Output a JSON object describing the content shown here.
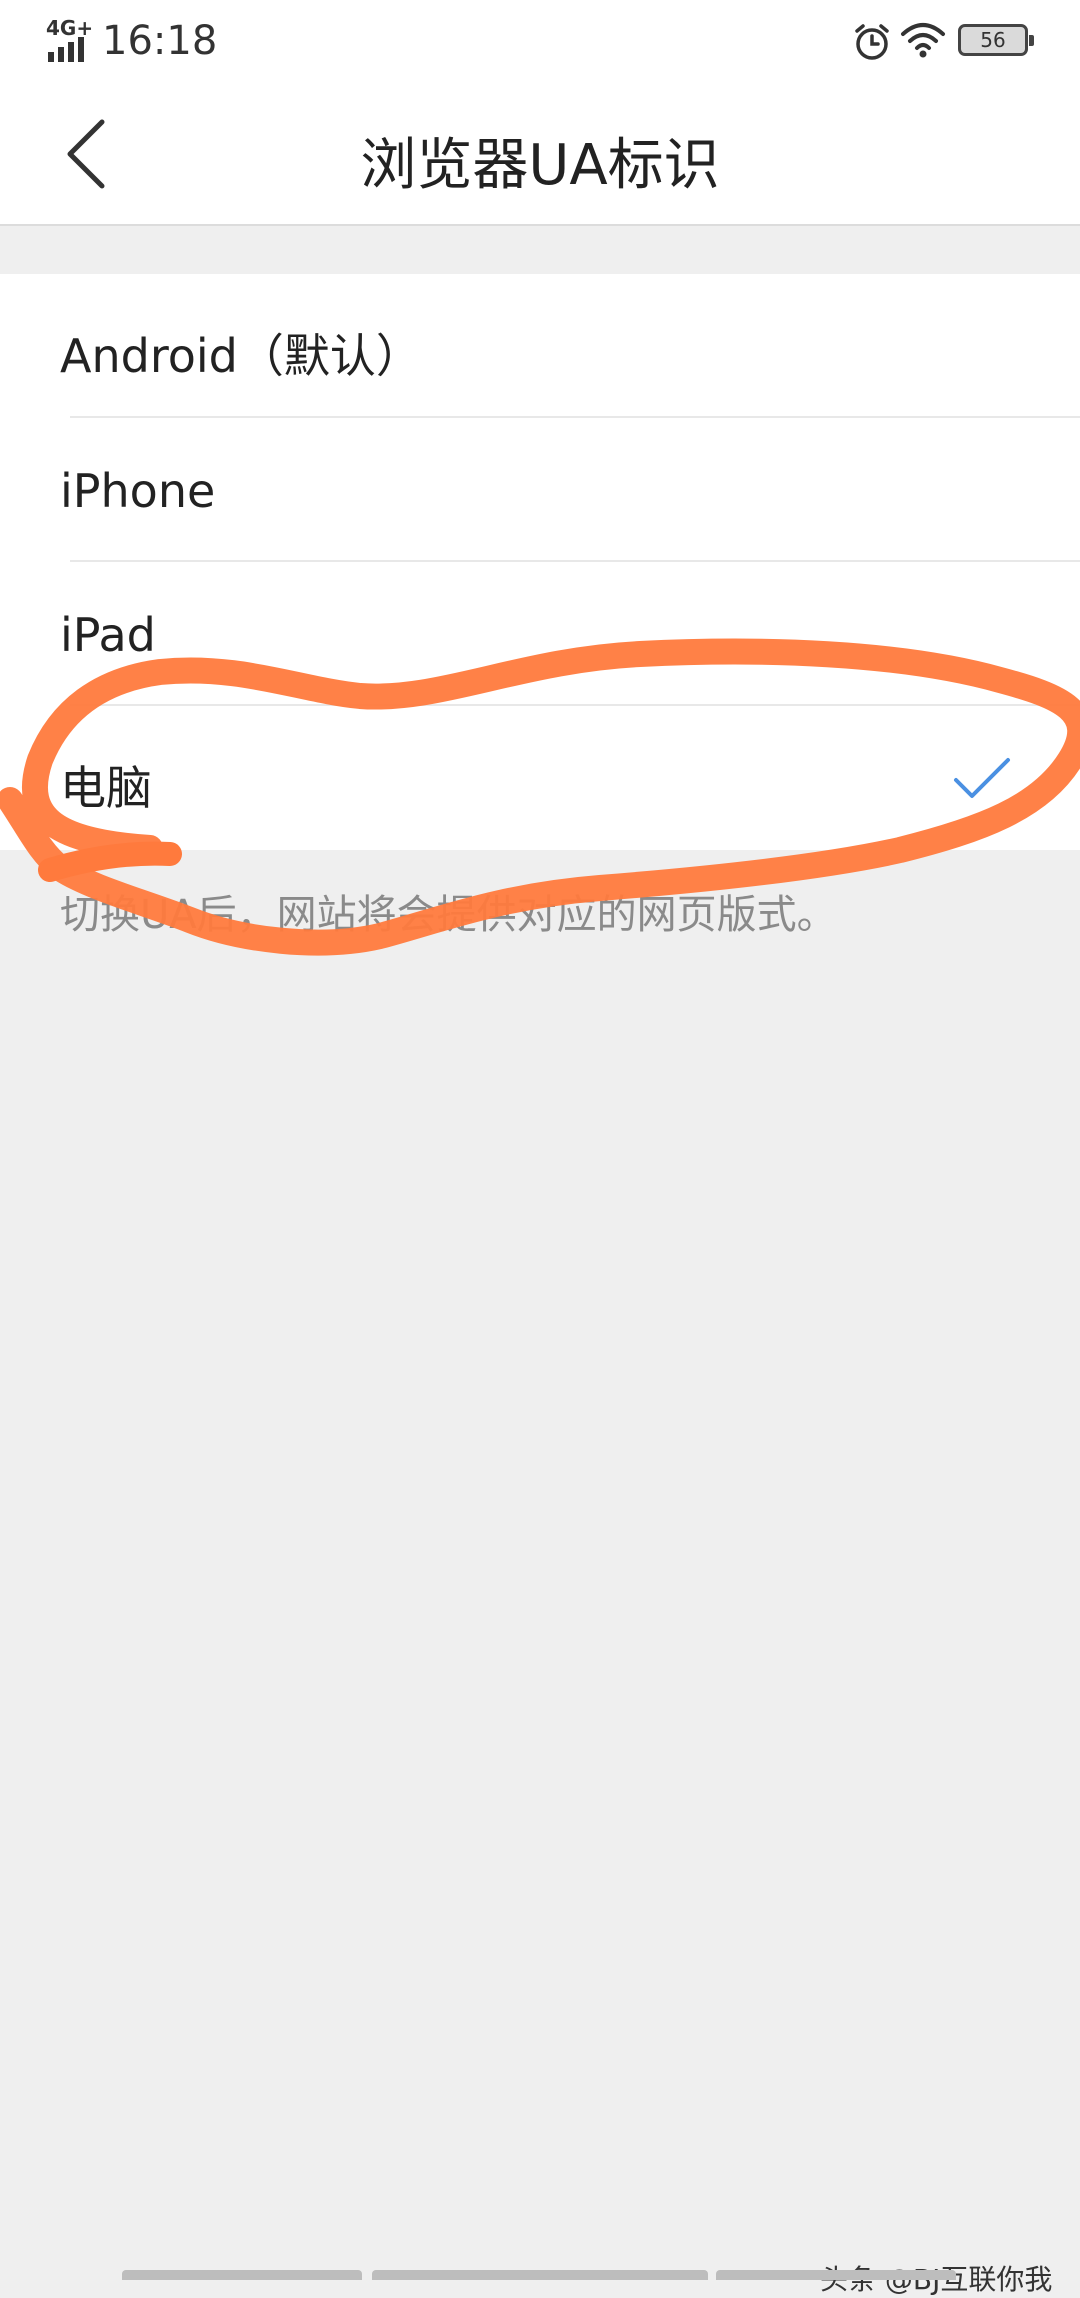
{
  "status_bar": {
    "network": "4G+",
    "time": "16:18",
    "battery": "56",
    "icons": [
      "signal-icon",
      "alarm-icon",
      "wifi-icon",
      "battery-icon"
    ]
  },
  "header": {
    "title": "浏览器UA标识",
    "back_icon": "chevron-left-icon"
  },
  "options": [
    {
      "label": "Android（默认）",
      "selected": false
    },
    {
      "label": "iPhone",
      "selected": false
    },
    {
      "label": "iPad",
      "selected": false
    },
    {
      "label": "电脑",
      "selected": true
    }
  ],
  "hint": "切换UA后，网站将会提供对应的网页版式。",
  "watermark": "头条 @BJ互联你我",
  "colors": {
    "accent": "#4a90e2",
    "annotation": "#ff7a3d",
    "background": "#efefef"
  }
}
